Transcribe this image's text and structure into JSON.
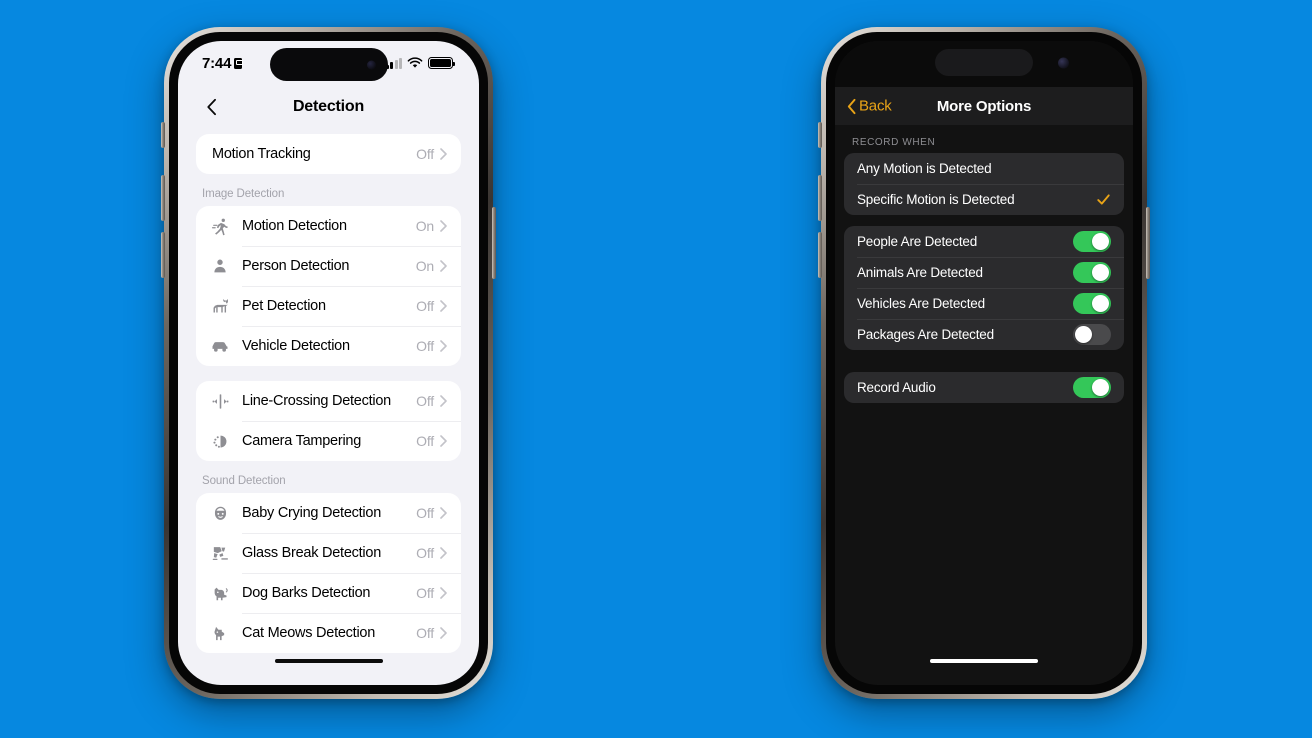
{
  "background_color": "#0688e0",
  "accent_orange": "#e8a317",
  "accent_green": "#34c759",
  "left_phone": {
    "status_bar": {
      "time": "7:44",
      "lock_icon": "lock-portrait-icon",
      "signal_icon": "cellular-signal-icon",
      "wifi_icon": "wifi-icon",
      "battery_icon": "battery-full-icon"
    },
    "nav": {
      "back_icon": "chevron-left-icon",
      "title": "Detection"
    },
    "sections": [
      {
        "header": "",
        "rows": [
          {
            "icon": "",
            "label": "Motion Tracking",
            "value": "Off",
            "chevron": "chevron-right-icon"
          }
        ]
      },
      {
        "header": "Image Detection",
        "rows": [
          {
            "icon": "running-person-icon",
            "label": "Motion Detection",
            "value": "On",
            "chevron": "chevron-right-icon"
          },
          {
            "icon": "person-icon",
            "label": "Person Detection",
            "value": "On",
            "chevron": "chevron-right-icon"
          },
          {
            "icon": "dog-icon",
            "label": "Pet Detection",
            "value": "Off",
            "chevron": "chevron-right-icon"
          },
          {
            "icon": "car-icon",
            "label": "Vehicle Detection",
            "value": "Off",
            "chevron": "chevron-right-icon"
          }
        ]
      },
      {
        "header": "",
        "rows": [
          {
            "icon": "line-crossing-icon",
            "label": "Line-Crossing Detection",
            "value": "Off",
            "chevron": "chevron-right-icon"
          },
          {
            "icon": "camera-tampering-icon",
            "label": "Camera Tampering",
            "value": "Off",
            "chevron": "chevron-right-icon"
          }
        ]
      },
      {
        "header": "Sound Detection",
        "rows": [
          {
            "icon": "baby-face-icon",
            "label": "Baby Crying Detection",
            "value": "Off",
            "chevron": "chevron-right-icon"
          },
          {
            "icon": "glass-break-icon",
            "label": "Glass Break Detection",
            "value": "Off",
            "chevron": "chevron-right-icon"
          },
          {
            "icon": "dog-barking-icon",
            "label": "Dog Barks Detection",
            "value": "Off",
            "chevron": "chevron-right-icon"
          },
          {
            "icon": "cat-meowing-icon",
            "label": "Cat Meows Detection",
            "value": "Off",
            "chevron": "chevron-right-icon"
          }
        ]
      }
    ]
  },
  "right_phone": {
    "nav": {
      "back_icon": "chevron-left-icon",
      "back_label": "Back",
      "title": "More Options"
    },
    "record_when": {
      "header": "RECORD WHEN",
      "options": [
        {
          "label": "Any Motion is Detected",
          "selected": false,
          "check_icon": "checkmark-icon"
        },
        {
          "label": "Specific Motion is Detected",
          "selected": true,
          "check_icon": "checkmark-icon"
        }
      ]
    },
    "detection_toggles": [
      {
        "label": "People Are Detected",
        "state": "on"
      },
      {
        "label": "Animals Are Detected",
        "state": "on"
      },
      {
        "label": "Vehicles Are Detected",
        "state": "on"
      },
      {
        "label": "Packages Are Detected",
        "state": "off"
      }
    ],
    "audio_toggles": [
      {
        "label": "Record Audio",
        "state": "on"
      }
    ]
  }
}
